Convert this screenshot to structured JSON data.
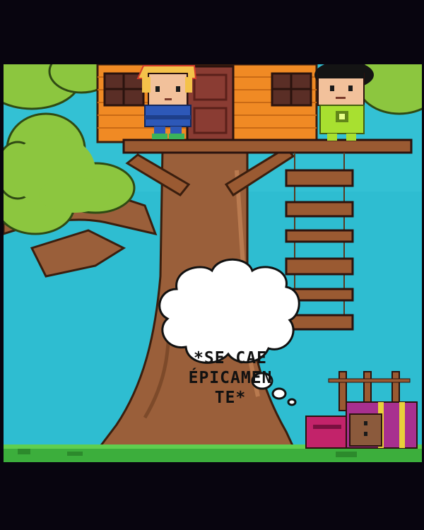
{
  "comic": {
    "thought_lines": [
      "*SE CAE",
      "ÉPICAMEN",
      "TE*"
    ]
  },
  "colors": {
    "background": "#08050f",
    "sky": "#2ebdd1",
    "trunk": "#9a5f3a",
    "foliage": "#8cc63f",
    "house": "#f08a24",
    "ladder": "#9a5a32"
  }
}
